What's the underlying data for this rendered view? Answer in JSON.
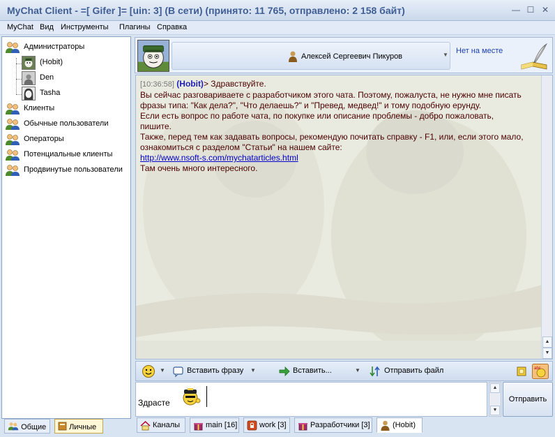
{
  "window": {
    "title": "MyChat Client - =[ Gifer ]= [uin: 3] (В сети) (принято: 11 765, отправлено: 2 158 байт)",
    "minimize": "—",
    "maximize": "☐",
    "close": "✕"
  },
  "menu": [
    "MyChat",
    "Вид",
    "Инструменты",
    "Плагины",
    "Справка"
  ],
  "contacts": {
    "groups": [
      {
        "label": "Администраторы",
        "icon": "users-group-icon"
      },
      {
        "label": "Клиенты",
        "icon": "users-group-icon"
      },
      {
        "label": "Обычные пользователи",
        "icon": "users-group-icon"
      },
      {
        "label": "Операторы",
        "icon": "users-group-icon"
      },
      {
        "label": "Потенциальные клиенты",
        "icon": "users-group-icon"
      },
      {
        "label": "Продвинутые пользователи",
        "icon": "users-group-icon"
      }
    ],
    "admin_users": [
      "(Hobit)",
      "Den",
      "Tasha"
    ]
  },
  "left_tabs": [
    "Общие",
    "Личные"
  ],
  "chat_header": {
    "name": "Алексей Сергеевич Пикуров",
    "status": "Нет на месте"
  },
  "messages": {
    "timestamp": "[10:36:58]",
    "nick": "(Hobit)",
    "greeting": "> Здравствуйте.",
    "line1": "Вы сейчас разговариваете с разработчиком этого чата. Поэтому, пожалуста, не нужно мне писать фразы типа: \"Как дела?\", \"Что делаешь?\" и \"Превед, медвед!\" и тому подобную ерунду.",
    "line2": "Если есть вопрос по работе чата, по покупке или описание проблемы - добро пожаловать, пишите.",
    "line3": "Также, перед тем как задавать вопросы, рекомендую почитать справку - F1, или, если этого мало, ознакомиться с разделом \"Статьи\" на нашем сайте:",
    "link": "http://www.nsoft-s.com/mychatarticles.html",
    "line4": "Там очень много интересного."
  },
  "toolbar": {
    "insert_phrase": "Вставить фразу",
    "insert": "Вставить...",
    "send_file": "Отправить файл"
  },
  "input": {
    "text": "Здрасте"
  },
  "send_button": "Отправить",
  "bottom_tabs": [
    {
      "label": "Каналы",
      "icon": "home-icon"
    },
    {
      "label": "main [16]",
      "icon": "gift-icon"
    },
    {
      "label": "work [3]",
      "icon": "lock-icon"
    },
    {
      "label": "Разработчики [3]",
      "icon": "gift-icon"
    },
    {
      "label": "(Hobit)",
      "icon": "user-icon"
    }
  ],
  "colors": {
    "title": "#3f5e95",
    "chat_text": "#4b0000",
    "nick": "#1f1fb8",
    "status": "#1c3fb0",
    "link": "#0000cc"
  }
}
